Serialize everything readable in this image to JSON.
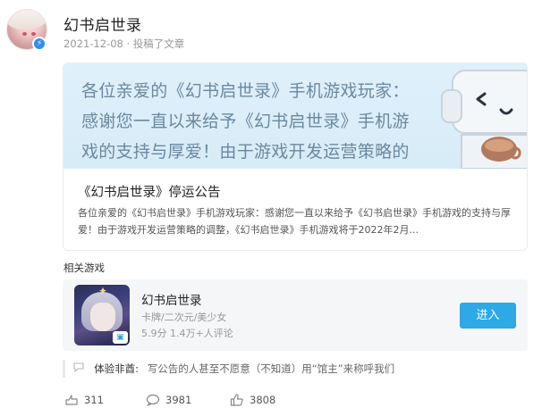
{
  "author": {
    "name": "幻书启世录",
    "date": "2021-12-08",
    "action": "· 投稿了文章"
  },
  "article": {
    "banner_text": "各位亲爱的《幻书启世录》手机游戏玩家：感谢您一直以来给予《幻书启世录》手机游戏的支持与厚爱！由于游戏开发运营策略的调整，《...",
    "title": "《幻书启世录》停运公告",
    "summary": "各位亲爱的《幻书启世录》手机游戏玩家：感谢您一直以来给予《幻书启世录》手机游戏的支持与厚爱！由于游戏开发运营策略的调整，《幻书启世录》手机游戏将于2022年2月..."
  },
  "related": {
    "label": "相关游戏",
    "game": {
      "name": "幻书启世录",
      "tags": "卡牌/二次元/美少女",
      "rating": "5.9分 1.4万+人评论",
      "enter_label": "进入"
    }
  },
  "comment": {
    "user": "体验非酋:",
    "text": "写公告的人甚至不愿意（不知道）用“馆主”来称呼我们"
  },
  "stats": {
    "shares": "311",
    "comments": "3981",
    "likes": "3808"
  },
  "colors": {
    "accent": "#2da9e6",
    "verify_badge": "#2f8ef0",
    "banner_bg": "#dff0fa"
  }
}
